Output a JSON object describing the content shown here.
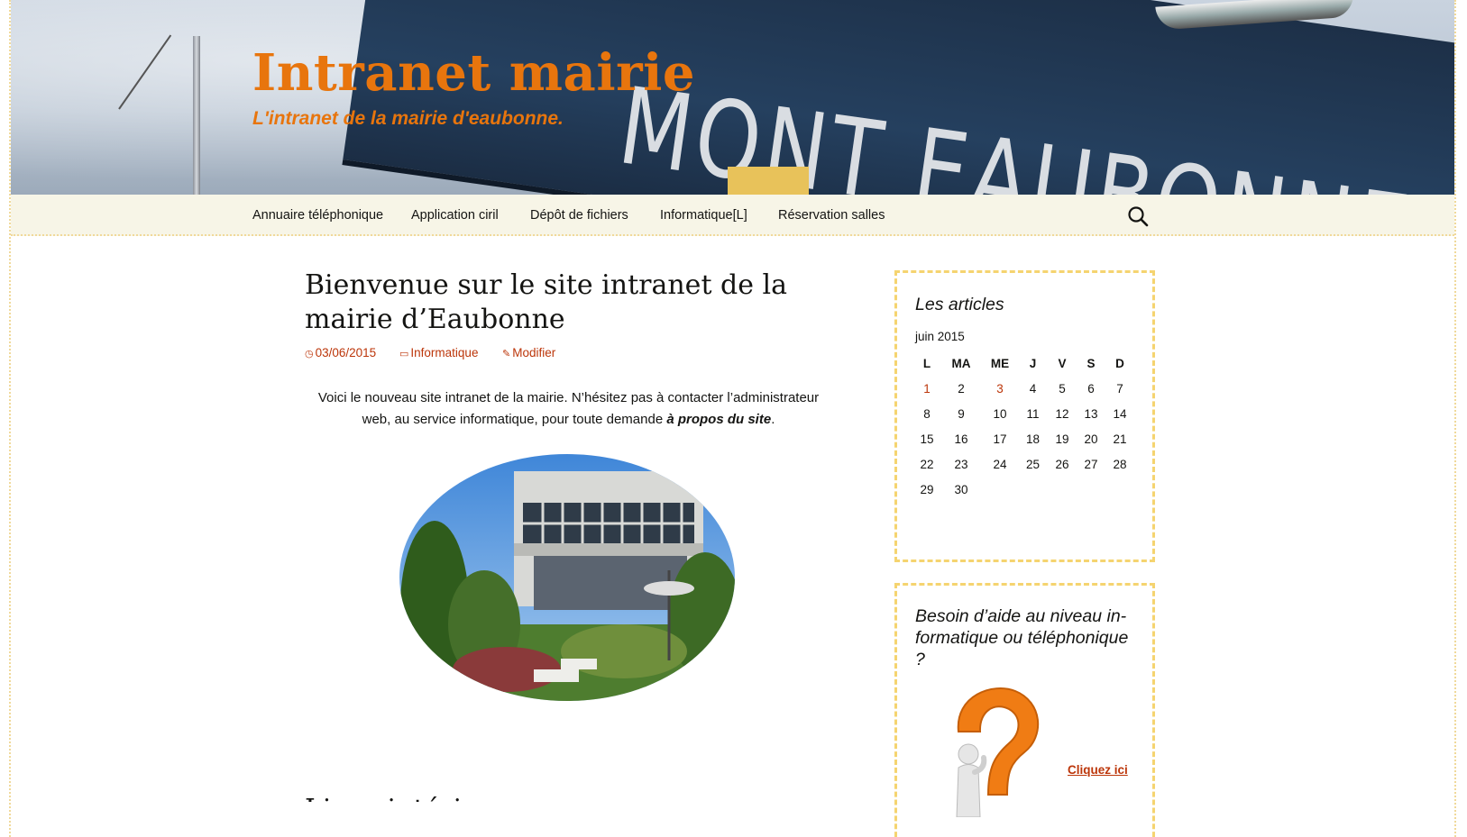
{
  "header": {
    "site_title": "Intranet mairie",
    "site_description": "L'intranet de la mairie d'eaubonne.",
    "banner_sign_text": "MONT EAUBONNE"
  },
  "nav": {
    "items": [
      {
        "label": "Annuaire téléphonique"
      },
      {
        "label": "Application ciril"
      },
      {
        "label": "Dépôt de fichiers"
      },
      {
        "label": "Informatique[L]"
      },
      {
        "label": "Réservation salles"
      }
    ],
    "search_icon": "search-icon"
  },
  "post": {
    "title": "Bienvenue sur le site intranet de la mairie d’Eaubonne",
    "date": "03/06/2015",
    "category": "Informatique",
    "edit": "Modifier",
    "body_text": "Voici le nouveau site intranet de la mairie. N’hésitez pas à contacter l’administrateur web, au service informatique, pour toute demande ",
    "body_link": "à propos du site",
    "body_end": ".",
    "next_title": "Liens intérieurs"
  },
  "sidebar": {
    "calendar_widget": {
      "title": "Les articles",
      "caption": "juin 2015",
      "headers": [
        "L",
        "MA",
        "ME",
        "J",
        "V",
        "S",
        "D"
      ],
      "weeks": [
        [
          "1",
          "2",
          "3",
          "4",
          "5",
          "6",
          "7"
        ],
        [
          "8",
          "9",
          "10",
          "11",
          "12",
          "13",
          "14"
        ],
        [
          "15",
          "16",
          "17",
          "18",
          "19",
          "20",
          "21"
        ],
        [
          "22",
          "23",
          "24",
          "25",
          "26",
          "27",
          "28"
        ],
        [
          "29",
          "30",
          "",
          "",
          "",
          "",
          ""
        ]
      ],
      "linked_days": [
        "1",
        "3"
      ]
    },
    "help_widget": {
      "title": "Besoin d’aide au niveau in-formatique ou téléphonique ?",
      "link": "Cliquez ici"
    }
  },
  "colors": {
    "accent_orange": "#e8750d",
    "link_red": "#bc360a",
    "nav_bg": "#f7f5e7",
    "widget_border": "#f5d470"
  }
}
